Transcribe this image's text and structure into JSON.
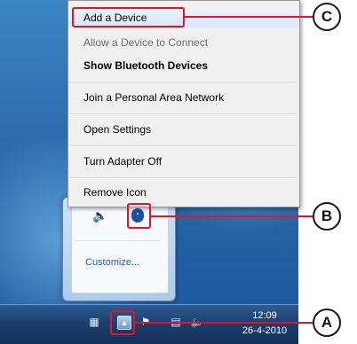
{
  "context_menu": {
    "items": [
      {
        "label": "Add a Device",
        "state": "highlighted"
      },
      {
        "label": "Allow a Device to Connect",
        "state": "disabled"
      },
      {
        "label": "Show Bluetooth Devices",
        "state": "default-bold"
      },
      {
        "label": "Join a Personal Area Network",
        "state": "normal"
      },
      {
        "label": "Open Settings",
        "state": "normal"
      },
      {
        "label": "Turn Adapter Off",
        "state": "normal"
      },
      {
        "label": "Remove Icon",
        "state": "normal"
      }
    ]
  },
  "tray_popup": {
    "customize_label": "Customize..."
  },
  "taskbar": {
    "time": "12:09",
    "date": "26-4-2010"
  },
  "callouts": {
    "a": "A",
    "b": "B",
    "c": "C"
  },
  "colors": {
    "highlight_red": "#e0142b",
    "taskbar": "#1c3f6e",
    "desktop": "#2f6fb0"
  },
  "icons": [
    "speaker-icon",
    "bluetooth-icon",
    "show-hidden-icons-arrow",
    "network-icon",
    "action-center-icon",
    "volume-icon",
    "laptop-icon"
  ]
}
